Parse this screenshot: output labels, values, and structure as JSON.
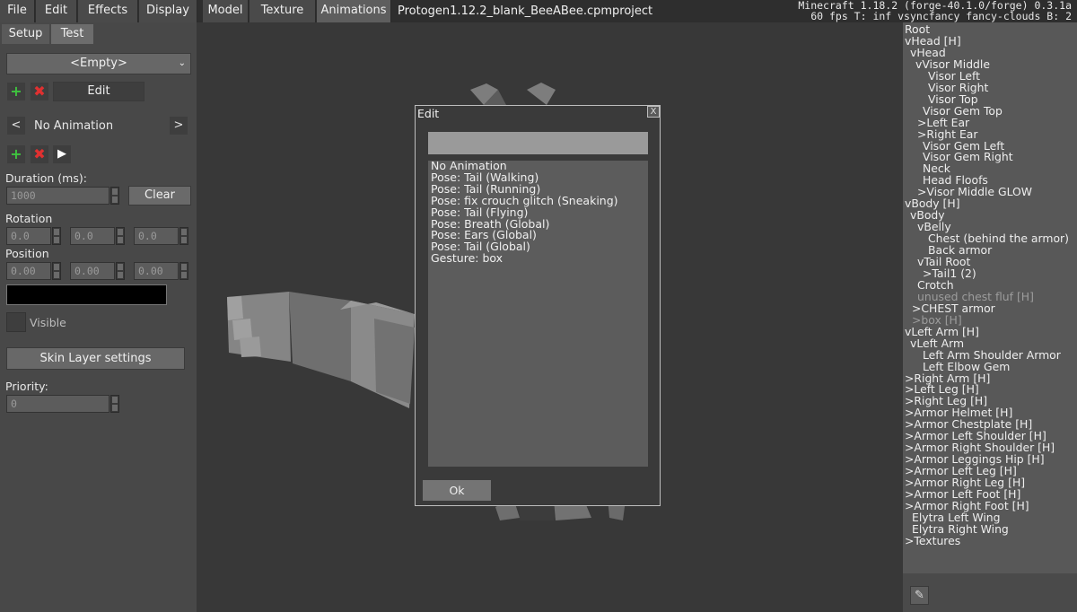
{
  "menubar": {
    "items": [
      "File",
      "Edit",
      "Effects",
      "Display"
    ],
    "tabs": [
      "Model",
      "Texture",
      "Animations"
    ],
    "active_tab": "Animations",
    "project_title": "Protogen1.12.2_blank_BeeABee.cpmproject",
    "mc_version_line": "Minecraft 1.18.2 (forge-40.1.0/forge) 0.3.1a",
    "fps_line": "60 fps T: inf vsyncfancy fancy-clouds B: 2"
  },
  "left": {
    "tabs": [
      "Setup",
      "Test"
    ],
    "active_tab": "Test",
    "dropdown_value": "<Empty>",
    "edit_label": "Edit",
    "anim_name": "No Animation",
    "duration_label": "Duration (ms):",
    "duration_value": "1000",
    "clear_label": "Clear",
    "rotation_label": "Rotation",
    "rotation_values": [
      "0.0",
      "0.0",
      "0.0"
    ],
    "position_label": "Position",
    "position_values": [
      "0.00",
      "0.00",
      "0.00"
    ],
    "visible_label": "Visible",
    "skin_layer_label": "Skin Layer settings",
    "priority_label": "Priority:",
    "priority_value": "0",
    "color_swatch": "#000000"
  },
  "dialog": {
    "title": "Edit",
    "close_label": "X",
    "input_value": "",
    "list": [
      "No Animation",
      "Pose: Tail (Walking)",
      "Pose: Tail (Running)",
      "Pose: fix crouch glitch (Sneaking)",
      "Pose: Tail (Flying)",
      "Pose: Breath (Global)",
      "Pose: Ears (Global)",
      "Pose: Tail (Global)",
      "Gesture: box"
    ],
    "ok_label": "Ok"
  },
  "tree": {
    "items": [
      {
        "label": "Root",
        "prefix": "",
        "muted": false
      },
      {
        "label": "Head [H]",
        "prefix": "v",
        "muted": false
      },
      {
        "label": "Head",
        "prefix": "v",
        "muted": false
      },
      {
        "label": "Visor Middle",
        "prefix": "v",
        "muted": false
      },
      {
        "label": "Visor Left",
        "prefix": "",
        "muted": false
      },
      {
        "label": "Visor Right",
        "prefix": "",
        "muted": false
      },
      {
        "label": "Visor Top",
        "prefix": "",
        "muted": false
      },
      {
        "label": "Visor Gem Top",
        "prefix": "",
        "muted": false
      },
      {
        "label": "Left Ear",
        "prefix": ">",
        "muted": false
      },
      {
        "label": "Right Ear",
        "prefix": ">",
        "muted": false
      },
      {
        "label": "Visor Gem Left",
        "prefix": "",
        "muted": false
      },
      {
        "label": "Visor Gem Right",
        "prefix": "",
        "muted": false
      },
      {
        "label": "Neck",
        "prefix": "",
        "muted": false
      },
      {
        "label": "Head Floofs",
        "prefix": "",
        "muted": false
      },
      {
        "label": "Visor Middle GLOW",
        "prefix": ">",
        "muted": false
      },
      {
        "label": "Body [H]",
        "prefix": "v",
        "muted": false
      },
      {
        "label": "Body",
        "prefix": "v",
        "muted": false
      },
      {
        "label": "Belly",
        "prefix": "v",
        "muted": false
      },
      {
        "label": "Chest (behind the armor)",
        "prefix": "",
        "muted": false
      },
      {
        "label": "Back armor",
        "prefix": "",
        "muted": false
      },
      {
        "label": "Tail Root",
        "prefix": "v",
        "muted": false
      },
      {
        "label": "Tail1 (2)",
        "prefix": ">",
        "muted": false
      },
      {
        "label": "Crotch",
        "prefix": "",
        "muted": false
      },
      {
        "label": "unused chest fluf [H]",
        "prefix": "",
        "muted": true
      },
      {
        "label": "CHEST armor",
        "prefix": ">",
        "muted": false
      },
      {
        "label": "box [H]",
        "prefix": ">",
        "muted": true
      },
      {
        "label": "Left Arm [H]",
        "prefix": "v",
        "muted": false
      },
      {
        "label": "Left Arm",
        "prefix": "v",
        "muted": false
      },
      {
        "label": "Left Arm Shoulder Armor",
        "prefix": "",
        "muted": false
      },
      {
        "label": "Left Elbow Gem",
        "prefix": "",
        "muted": false
      },
      {
        "label": "Right Arm [H]",
        "prefix": ">",
        "muted": false
      },
      {
        "label": "Left Leg [H]",
        "prefix": ">",
        "muted": false
      },
      {
        "label": "Right Leg [H]",
        "prefix": ">",
        "muted": false
      },
      {
        "label": "Armor Helmet [H]",
        "prefix": ">",
        "muted": false
      },
      {
        "label": "Armor Chestplate [H]",
        "prefix": ">",
        "muted": false
      },
      {
        "label": "Armor Left Shoulder [H]",
        "prefix": ">",
        "muted": false
      },
      {
        "label": "Armor Right Shoulder [H]",
        "prefix": ">",
        "muted": false
      },
      {
        "label": "Armor Leggings Hip [H]",
        "prefix": ">",
        "muted": false
      },
      {
        "label": "Armor Left Leg [H]",
        "prefix": ">",
        "muted": false
      },
      {
        "label": "Armor Right Leg [H]",
        "prefix": ">",
        "muted": false
      },
      {
        "label": "Armor Left Foot [H]",
        "prefix": ">",
        "muted": false
      },
      {
        "label": "Armor Right Foot [H]",
        "prefix": ">",
        "muted": false
      },
      {
        "label": "Elytra Left Wing",
        "prefix": "",
        "muted": false
      },
      {
        "label": "Elytra Right Wing",
        "prefix": "",
        "muted": false
      },
      {
        "label": "Textures",
        "prefix": ">",
        "muted": false
      }
    ]
  }
}
